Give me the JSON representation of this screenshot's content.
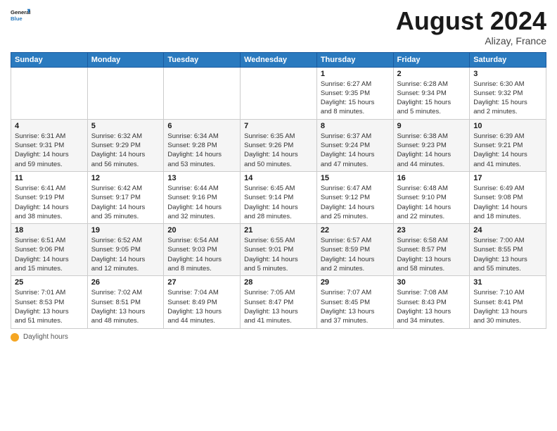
{
  "header": {
    "logo_line1": "General",
    "logo_line2": "Blue",
    "month_title": "August 2024",
    "location": "Alizay, France"
  },
  "days_of_week": [
    "Sunday",
    "Monday",
    "Tuesday",
    "Wednesday",
    "Thursday",
    "Friday",
    "Saturday"
  ],
  "weeks": [
    [
      {
        "day": "",
        "info": ""
      },
      {
        "day": "",
        "info": ""
      },
      {
        "day": "",
        "info": ""
      },
      {
        "day": "",
        "info": ""
      },
      {
        "day": "1",
        "info": "Sunrise: 6:27 AM\nSunset: 9:35 PM\nDaylight: 15 hours\nand 8 minutes."
      },
      {
        "day": "2",
        "info": "Sunrise: 6:28 AM\nSunset: 9:34 PM\nDaylight: 15 hours\nand 5 minutes."
      },
      {
        "day": "3",
        "info": "Sunrise: 6:30 AM\nSunset: 9:32 PM\nDaylight: 15 hours\nand 2 minutes."
      }
    ],
    [
      {
        "day": "4",
        "info": "Sunrise: 6:31 AM\nSunset: 9:31 PM\nDaylight: 14 hours\nand 59 minutes."
      },
      {
        "day": "5",
        "info": "Sunrise: 6:32 AM\nSunset: 9:29 PM\nDaylight: 14 hours\nand 56 minutes."
      },
      {
        "day": "6",
        "info": "Sunrise: 6:34 AM\nSunset: 9:28 PM\nDaylight: 14 hours\nand 53 minutes."
      },
      {
        "day": "7",
        "info": "Sunrise: 6:35 AM\nSunset: 9:26 PM\nDaylight: 14 hours\nand 50 minutes."
      },
      {
        "day": "8",
        "info": "Sunrise: 6:37 AM\nSunset: 9:24 PM\nDaylight: 14 hours\nand 47 minutes."
      },
      {
        "day": "9",
        "info": "Sunrise: 6:38 AM\nSunset: 9:23 PM\nDaylight: 14 hours\nand 44 minutes."
      },
      {
        "day": "10",
        "info": "Sunrise: 6:39 AM\nSunset: 9:21 PM\nDaylight: 14 hours\nand 41 minutes."
      }
    ],
    [
      {
        "day": "11",
        "info": "Sunrise: 6:41 AM\nSunset: 9:19 PM\nDaylight: 14 hours\nand 38 minutes."
      },
      {
        "day": "12",
        "info": "Sunrise: 6:42 AM\nSunset: 9:17 PM\nDaylight: 14 hours\nand 35 minutes."
      },
      {
        "day": "13",
        "info": "Sunrise: 6:44 AM\nSunset: 9:16 PM\nDaylight: 14 hours\nand 32 minutes."
      },
      {
        "day": "14",
        "info": "Sunrise: 6:45 AM\nSunset: 9:14 PM\nDaylight: 14 hours\nand 28 minutes."
      },
      {
        "day": "15",
        "info": "Sunrise: 6:47 AM\nSunset: 9:12 PM\nDaylight: 14 hours\nand 25 minutes."
      },
      {
        "day": "16",
        "info": "Sunrise: 6:48 AM\nSunset: 9:10 PM\nDaylight: 14 hours\nand 22 minutes."
      },
      {
        "day": "17",
        "info": "Sunrise: 6:49 AM\nSunset: 9:08 PM\nDaylight: 14 hours\nand 18 minutes."
      }
    ],
    [
      {
        "day": "18",
        "info": "Sunrise: 6:51 AM\nSunset: 9:06 PM\nDaylight: 14 hours\nand 15 minutes."
      },
      {
        "day": "19",
        "info": "Sunrise: 6:52 AM\nSunset: 9:05 PM\nDaylight: 14 hours\nand 12 minutes."
      },
      {
        "day": "20",
        "info": "Sunrise: 6:54 AM\nSunset: 9:03 PM\nDaylight: 14 hours\nand 8 minutes."
      },
      {
        "day": "21",
        "info": "Sunrise: 6:55 AM\nSunset: 9:01 PM\nDaylight: 14 hours\nand 5 minutes."
      },
      {
        "day": "22",
        "info": "Sunrise: 6:57 AM\nSunset: 8:59 PM\nDaylight: 14 hours\nand 2 minutes."
      },
      {
        "day": "23",
        "info": "Sunrise: 6:58 AM\nSunset: 8:57 PM\nDaylight: 13 hours\nand 58 minutes."
      },
      {
        "day": "24",
        "info": "Sunrise: 7:00 AM\nSunset: 8:55 PM\nDaylight: 13 hours\nand 55 minutes."
      }
    ],
    [
      {
        "day": "25",
        "info": "Sunrise: 7:01 AM\nSunset: 8:53 PM\nDaylight: 13 hours\nand 51 minutes."
      },
      {
        "day": "26",
        "info": "Sunrise: 7:02 AM\nSunset: 8:51 PM\nDaylight: 13 hours\nand 48 minutes."
      },
      {
        "day": "27",
        "info": "Sunrise: 7:04 AM\nSunset: 8:49 PM\nDaylight: 13 hours\nand 44 minutes."
      },
      {
        "day": "28",
        "info": "Sunrise: 7:05 AM\nSunset: 8:47 PM\nDaylight: 13 hours\nand 41 minutes."
      },
      {
        "day": "29",
        "info": "Sunrise: 7:07 AM\nSunset: 8:45 PM\nDaylight: 13 hours\nand 37 minutes."
      },
      {
        "day": "30",
        "info": "Sunrise: 7:08 AM\nSunset: 8:43 PM\nDaylight: 13 hours\nand 34 minutes."
      },
      {
        "day": "31",
        "info": "Sunrise: 7:10 AM\nSunset: 8:41 PM\nDaylight: 13 hours\nand 30 minutes."
      }
    ]
  ],
  "footer": {
    "label": "Daylight hours"
  }
}
